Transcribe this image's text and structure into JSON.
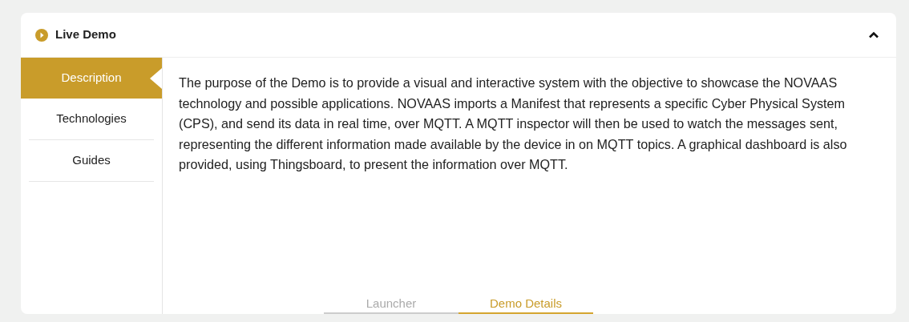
{
  "panel": {
    "title": "Live Demo",
    "expanded": true
  },
  "sidebar": {
    "items": [
      {
        "label": "Description",
        "selected": true
      },
      {
        "label": "Technologies",
        "selected": false
      },
      {
        "label": "Guides",
        "selected": false
      }
    ]
  },
  "content": {
    "text": "The purpose of the Demo is to provide a visual and interactive system with the objective to showcase the NOVAAS technology and possible applications. NOVAAS imports a Manifest that represents a specific Cyber Physical System (CPS), and send its data in real time, over MQTT. A MQTT inspector will then be used to watch the messages sent, representing the different information made available by the device in on MQTT topics. A graphical dashboard is also provided, using Thingsboard, to present the information over MQTT."
  },
  "tabs": [
    {
      "label": "Launcher",
      "selected": false
    },
    {
      "label": "Demo Details",
      "selected": true
    }
  ]
}
